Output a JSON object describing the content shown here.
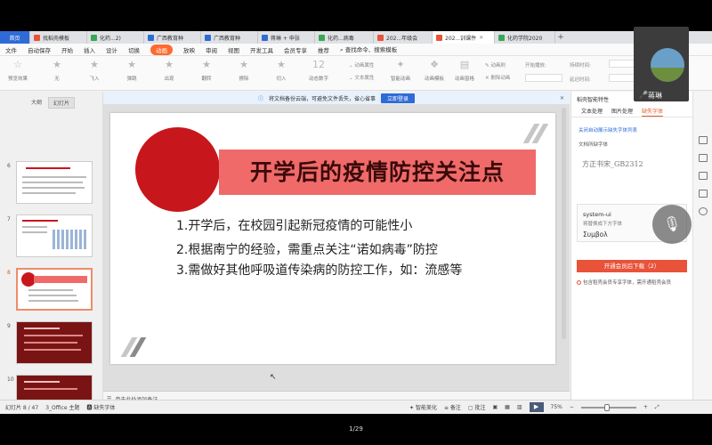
{
  "tabs": [
    {
      "label": "首页",
      "color": "#2f6bd6"
    },
    {
      "label": "找稻壳模板",
      "color": "#e8533a"
    },
    {
      "label": "化药...2)",
      "color": "#3aa757"
    },
    {
      "label": "广西教育种",
      "color": "#2f6bd6"
    },
    {
      "label": "广西教育种",
      "color": "#2f6bd6"
    },
    {
      "label": "蒋琳 + 申张",
      "color": "#2f6bd6"
    },
    {
      "label": "化药...病毒",
      "color": "#3aa757"
    },
    {
      "label": "202...年级会",
      "color": "#e8533a"
    },
    {
      "label": "202...训课件",
      "color": "#e8533a"
    },
    {
      "label": "化药学院2020",
      "color": "#3aa757"
    }
  ],
  "menu": {
    "file": "文件",
    "autosave": "自动保存",
    "start": "开始",
    "insert": "插入",
    "design": "设计",
    "transition": "切换",
    "animation": "动画",
    "slideshow": "放映",
    "review": "审阅",
    "view": "视图",
    "dev": "开发工具",
    "vip": "会员专享",
    "recommend": "推荐",
    "search": "查找命令、搜索模板"
  },
  "toolbar": {
    "preview": "预览效果",
    "none": "无",
    "fly": "飞入",
    "flash": "弹跳",
    "appear": "出现",
    "zoom": "翻转",
    "fade": "擦除",
    "cut": "切入",
    "dynamic": "动态数字",
    "anim_attr": "动画属性",
    "text_attr": "文本属性",
    "smart": "智能动画",
    "anim_template": "动画模板",
    "anim_window": "动画窗格",
    "delete_anim": "删除动画",
    "anim_brush": "动画刷",
    "start": "开始播放:",
    "duration": "持续时间:",
    "delay": "延迟时间:"
  },
  "notice": {
    "text": "将文档备份云端，可避免文件丢失，省心省事",
    "button": "立即登录"
  },
  "left_panel": {
    "tab_outline": "大纲",
    "tab_slides": "幻灯片",
    "thumbs": [
      "6",
      "7",
      "8",
      "9",
      "10"
    ],
    "add": "+"
  },
  "slide": {
    "title": "开学后的疫情防控关注点",
    "bullets": [
      "1.开学后，在校园引起新冠疫情的可能性小",
      "2.根据南宁的经验，需重点关注“诺如病毒”防控",
      "3.需做好其他呼吸道传染病的防控工作，如：流感等"
    ]
  },
  "notes_placeholder": "单击此处添加备注",
  "right_panel": {
    "header": "稻壳智能特性",
    "tab_text": "文本处理",
    "tab_image": "图片处理",
    "tab_font": "缺失字体",
    "link": "关闭自动展示缺失字体列表",
    "missing_label": "文档所缺字体",
    "font1": "方正书宋_GB2312",
    "font2": "system-ui",
    "font2_note": "将替换成下方字体",
    "font2_sample": "Συμβολ",
    "button": "开通会员后下载（2）",
    "note": "包含稻壳会员专享字体，需开通稻壳会员"
  },
  "status": {
    "slide": "幻灯片 8 / 47",
    "theme": "3_Office 主题",
    "missing": "缺失字体",
    "smart": "智能美化",
    "notes": "备注",
    "comment": "批注",
    "zoom": "75%"
  },
  "webcam": {
    "name": "蒋琳"
  },
  "page_counter": "1/29"
}
